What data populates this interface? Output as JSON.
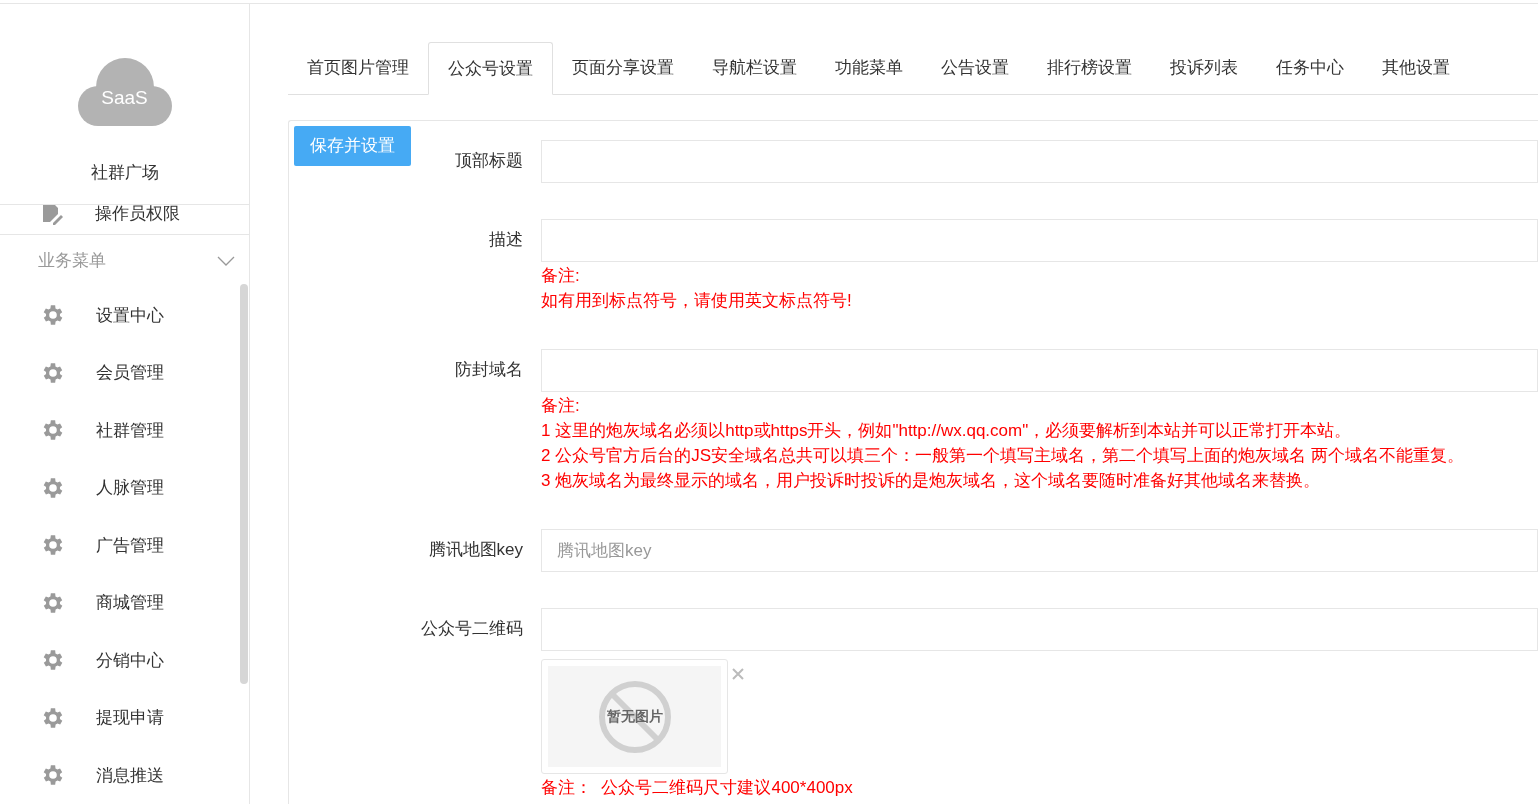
{
  "sidebar": {
    "logo_text": "SaaS",
    "site_name": "社群广场",
    "top_item": {
      "label": "操作员权限"
    },
    "group": {
      "title": "业务菜单",
      "expanded": true,
      "items": [
        {
          "label": "设置中心"
        },
        {
          "label": "会员管理"
        },
        {
          "label": "社群管理"
        },
        {
          "label": "人脉管理"
        },
        {
          "label": "广告管理"
        },
        {
          "label": "商城管理"
        },
        {
          "label": "分销中心"
        },
        {
          "label": "提现申请"
        },
        {
          "label": "消息推送"
        }
      ]
    }
  },
  "tabs": [
    {
      "label": "首页图片管理",
      "selected": false
    },
    {
      "label": "公众号设置",
      "selected": true
    },
    {
      "label": "页面分享设置",
      "selected": false
    },
    {
      "label": "导航栏设置",
      "selected": false
    },
    {
      "label": "功能菜单",
      "selected": false
    },
    {
      "label": "公告设置",
      "selected": false
    },
    {
      "label": "排行榜设置",
      "selected": false
    },
    {
      "label": "投诉列表",
      "selected": false
    },
    {
      "label": "任务中心",
      "selected": false
    },
    {
      "label": "其他设置",
      "selected": false
    }
  ],
  "save_button": "保存并设置",
  "fields": [
    {
      "kind": "text",
      "label": "顶部标题"
    },
    {
      "kind": "text",
      "label": "描述",
      "notes": [
        "备注:",
        "如有用到标点符号，请使用英文标点符号!"
      ]
    },
    {
      "kind": "text",
      "label": "防封域名",
      "notes": [
        "备注:",
        "1 这里的炮灰域名必须以http或https开头，例如\"http://wx.qq.com\"，必须要解析到本站并可以正常打开本站。",
        "2 公众号官方后台的JS安全域名总共可以填三个：一般第一个填写主域名，第二个填写上面的炮灰域名 两个域名不能重复。",
        "3 炮灰域名为最终显示的域名，用户投诉时投诉的是炮灰域名，这个域名要随时准备好其他域名来替换。"
      ]
    },
    {
      "kind": "text",
      "label": "腾讯地图key",
      "placeholder": "腾讯地图key"
    },
    {
      "kind": "image",
      "label": "公众号二维码",
      "image_text": "暂无图片",
      "notes": [
        "备注：  公众号二维码尺寸建议400*400px"
      ]
    }
  ]
}
